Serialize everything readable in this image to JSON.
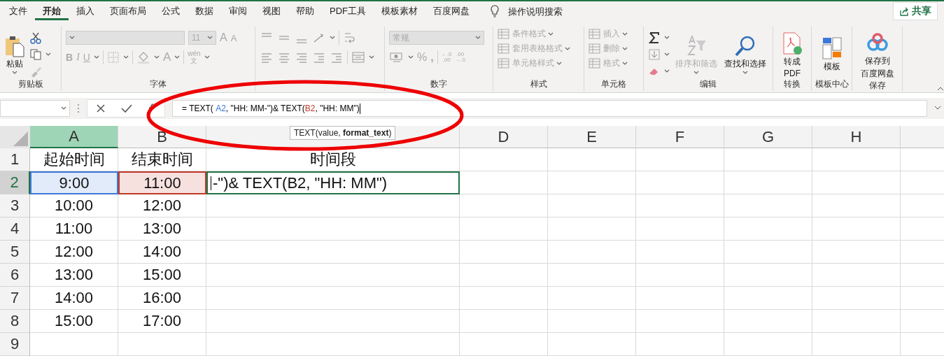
{
  "menu_tabs": [
    {
      "label": "文件",
      "selected": false
    },
    {
      "label": "开始",
      "selected": true
    },
    {
      "label": "插入",
      "selected": false
    },
    {
      "label": "页面布局",
      "selected": false
    },
    {
      "label": "公式",
      "selected": false
    },
    {
      "label": "数据",
      "selected": false
    },
    {
      "label": "审阅",
      "selected": false
    },
    {
      "label": "视图",
      "selected": false
    },
    {
      "label": "帮助",
      "selected": false
    },
    {
      "label": "PDF工具",
      "selected": false
    },
    {
      "label": "模板素材",
      "selected": false
    },
    {
      "label": "百度网盘",
      "selected": false
    }
  ],
  "tell_me": {
    "placeholder": "操作说明搜索"
  },
  "share_button": {
    "label": "共享"
  },
  "ribbon": {
    "clipboard": {
      "paste": "粘贴",
      "label": "剪贴板"
    },
    "font": {
      "font_size": "11",
      "grow": "A",
      "shrink": "A",
      "format_buttons": [
        "B",
        "I",
        "U"
      ],
      "font_color": "A",
      "phonetic_top": "wén",
      "phonetic_bottom": "文",
      "label": "字体"
    },
    "number": {
      "format": "常规",
      "percent": "%",
      "comma": ",",
      "decimals": [
        {
          "top": "←.0",
          "bottom": ".00"
        },
        {
          "top": ".00",
          "bottom": "→.0"
        }
      ],
      "label": "数字"
    },
    "styles": {
      "items": [
        {
          "label": "条件格式",
          "disabled": true
        },
        {
          "label": "套用表格格式",
          "disabled": true
        },
        {
          "label": "单元格样式",
          "disabled": true
        }
      ],
      "label": "样式"
    },
    "cells": {
      "items": [
        {
          "label": "插入",
          "disabled": true
        },
        {
          "label": "删除",
          "disabled": true
        },
        {
          "label": "格式",
          "disabled": true
        }
      ],
      "label": "单元格"
    },
    "editing": {
      "sort_filter": {
        "label": "排序和筛选",
        "disabled": true
      },
      "find_select": {
        "label": "查找和选择",
        "disabled": false
      },
      "label": "编辑"
    },
    "convert": {
      "button": [
        "转成",
        "PDF"
      ],
      "label": "转换"
    },
    "template": {
      "button": [
        "模板"
      ],
      "label": "模板中心"
    },
    "save": {
      "button": [
        "保存到",
        "百度网盘"
      ],
      "label": "保存"
    }
  },
  "formula_bar": {
    "formula": [
      {
        "text": "= TEXT( ",
        "color": "#000000"
      },
      {
        "text": "A2",
        "color": "#3b78d8"
      },
      {
        "text": ", \"HH: MM-\")& TEXT(",
        "color": "#000000"
      },
      {
        "text": "B2",
        "color": "#c0392b"
      },
      {
        "text": ", \"HH: MM\")",
        "color": "#000000"
      }
    ],
    "tooltip": "TEXT(value, **format_text**)"
  },
  "sheet": {
    "columns": [
      {
        "label": "A",
        "selected": true
      },
      {
        "label": "B",
        "selected": false
      },
      {
        "selected": false
      },
      {
        "label": "D",
        "selected": false
      },
      {
        "label": "E",
        "selected": false
      },
      {
        "label": "F",
        "selected": false
      },
      {
        "label": "G",
        "selected": false
      },
      {
        "label": "H",
        "selected": false
      }
    ],
    "rows": [
      {
        "header": "1",
        "selected": false,
        "cells": [
          {
            "text": "起始时间"
          },
          {
            "text": "结束时间"
          },
          {
            "text": "时间段"
          }
        ]
      },
      {
        "header": "2",
        "selected": true,
        "cells": [
          {
            "text": "9:00",
            "color": "#3b78d8"
          },
          {
            "text": "11:00",
            "color": "#c0392b"
          },
          {
            "text": "-\")& TEXT(B2, \"HH: MM\")",
            "kind": "editing"
          }
        ]
      },
      {
        "header": "3",
        "selected": false,
        "cells": [
          {
            "text": "10:00"
          },
          {
            "text": "12:00"
          }
        ]
      },
      {
        "header": "4",
        "selected": false,
        "cells": [
          {
            "text": "11:00"
          },
          {
            "text": "13:00"
          }
        ]
      },
      {
        "header": "5",
        "selected": false,
        "cells": [
          {
            "text": "12:00"
          },
          {
            "text": "14:00"
          }
        ]
      },
      {
        "header": "6",
        "selected": false,
        "cells": [
          {
            "text": "13:00"
          },
          {
            "text": "15:00"
          }
        ]
      },
      {
        "header": "7",
        "selected": false,
        "cells": [
          {
            "text": "14:00"
          },
          {
            "text": "16:00"
          }
        ]
      },
      {
        "header": "8",
        "selected": false,
        "cells": [
          {
            "text": "15:00"
          },
          {
            "text": "17:00"
          }
        ]
      },
      {
        "header": "9",
        "selected": false,
        "cells": []
      }
    ]
  }
}
